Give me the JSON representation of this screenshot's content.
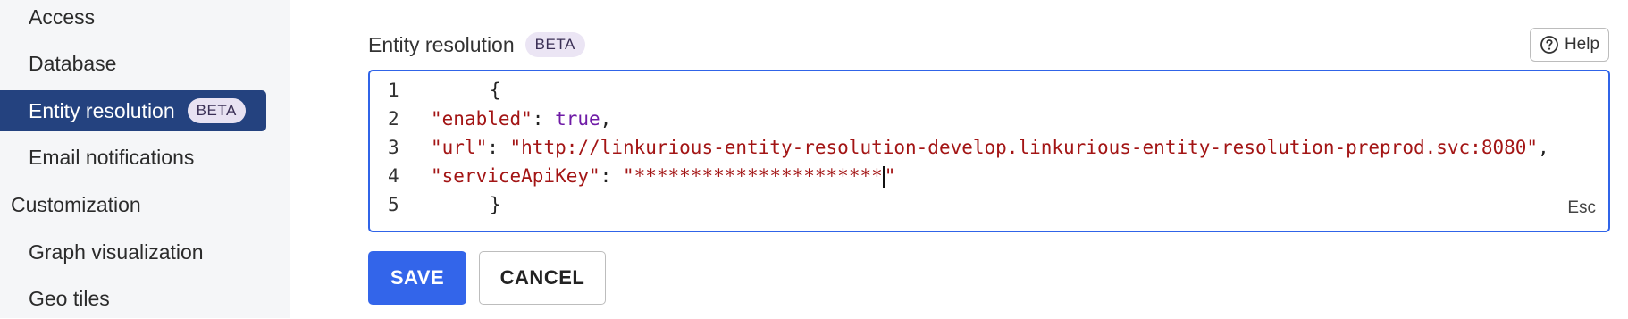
{
  "sidebar": {
    "items": [
      {
        "label": "Access"
      },
      {
        "label": "Database"
      },
      {
        "label": "Entity resolution",
        "badge": "BETA"
      },
      {
        "label": "Email notifications"
      },
      {
        "label": "Customization"
      },
      {
        "label": "Graph visualization"
      },
      {
        "label": "Geo tiles"
      }
    ]
  },
  "main": {
    "title": "Entity resolution",
    "title_badge": "BETA",
    "help_label": "Help",
    "editor": {
      "line_numbers": [
        "1",
        "2",
        "3",
        "4",
        "5"
      ],
      "open_brace": "{",
      "close_brace": "}",
      "enabled_key": "\"enabled\"",
      "enabled_value": "true",
      "url_key": "\"url\"",
      "url_value": "\"http://linkurious-entity-resolution-develop.linkurious-entity-resolution-preprod.svc:8080\"",
      "api_key_key": "\"serviceApiKey\"",
      "api_key_value": "\"**********************",
      "api_key_close_quote": "\"",
      "colon": ": ",
      "comma": ",",
      "esc_hint": "Esc"
    },
    "save_label": "SAVE",
    "cancel_label": "CANCEL"
  },
  "colors": {
    "accent": "#3365ea",
    "nav_active": "#24427f",
    "badge_bg": "#ebe5f4",
    "string_token": "#a31515",
    "boolean_token": "#6f1ba6"
  }
}
